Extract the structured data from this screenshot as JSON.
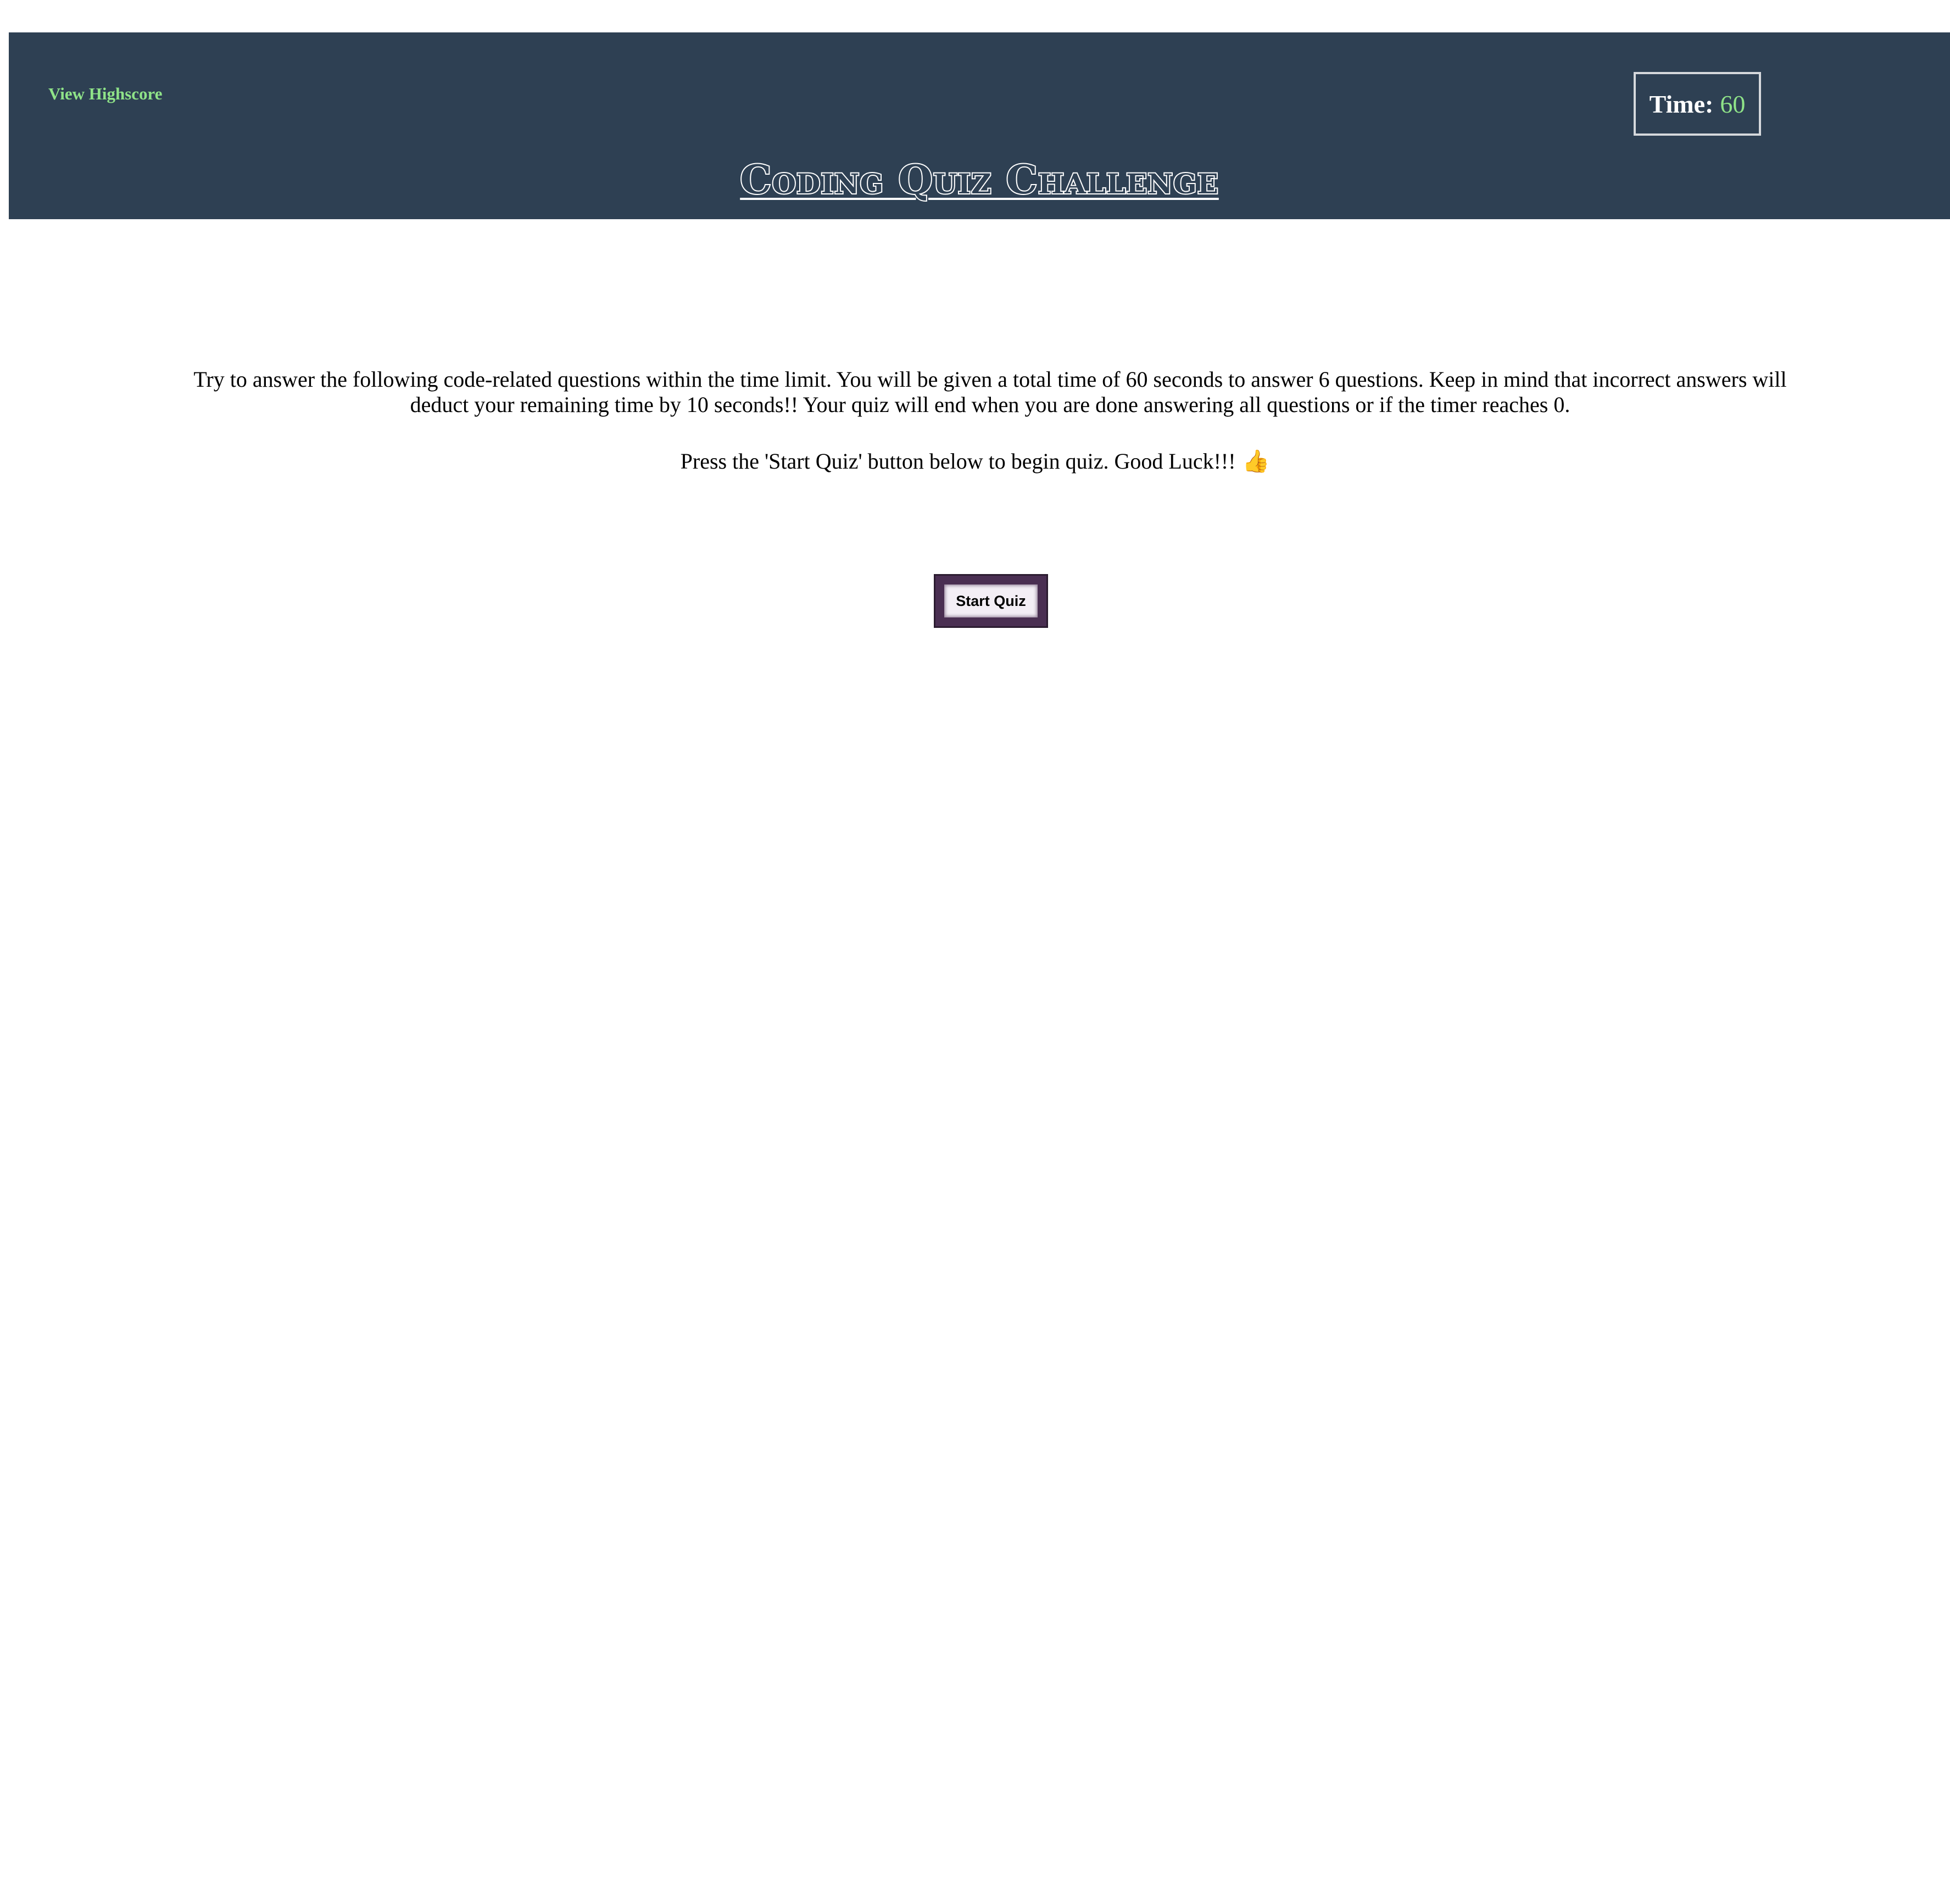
{
  "header": {
    "highscore_link": "View Highscore",
    "timer_label": "Time:",
    "timer_value": "60",
    "title": "Coding Quiz Challenge"
  },
  "main": {
    "instructions": "Try to answer the following code-related questions within the time limit. You will be given a total time of 60 seconds to answer 6 questions. Keep in mind that incorrect answers will deduct your remaining time by 10 seconds!! Your quiz will end when you are done answering all questions or if the timer reaches 0.",
    "press_text": "Press the 'Start Quiz' button below to begin quiz. Good Luck!!!",
    "thumb_icon": "👍",
    "start_button": "Start Quiz"
  },
  "colors": {
    "header_bg": "#2e4053",
    "accent_green": "#8fe388",
    "button_border": "#4a2f52",
    "thumb_icon": "#f5b617"
  },
  "icons": {
    "press_text_icon": "thumbs-up-icon"
  }
}
